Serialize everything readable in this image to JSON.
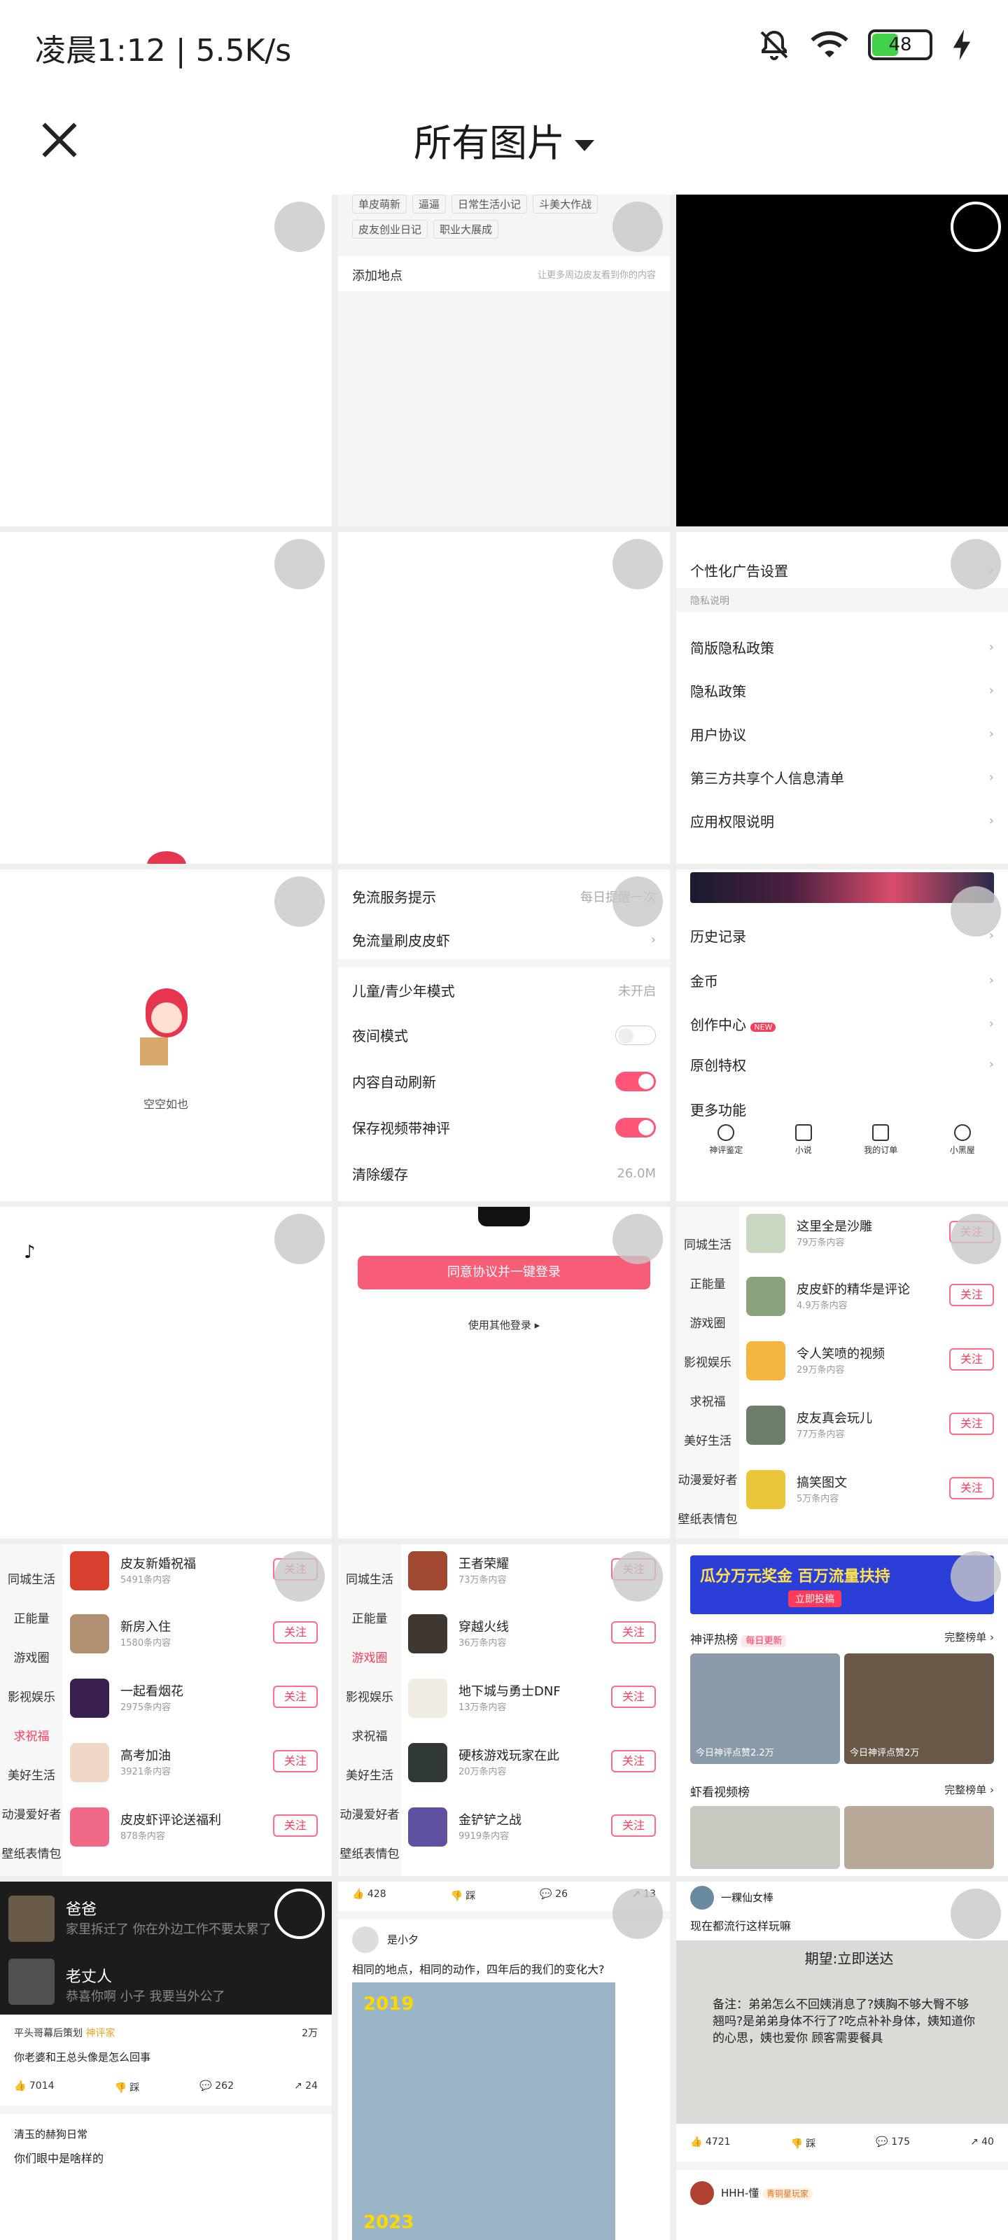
{
  "status": {
    "time": "凌晨1:12 | 5.5K/s",
    "battery": 48,
    "icons": [
      "bell-off-icon",
      "wifi-icon",
      "battery-icon",
      "charging-icon"
    ]
  },
  "header": {
    "title": "所有图片"
  },
  "colors": {
    "accent": "#ff3b5c",
    "toggle_on": "#ff5577"
  },
  "cell1_2": {
    "tags_row1": [
      "单皮萌新",
      "逼逼",
      "日常生活小记",
      "斗美大作战"
    ],
    "tags_row2": [
      "皮友创业日记",
      "职业大展成"
    ],
    "location": "添加地点",
    "location_hint": "让更多周边皮友看到你的内容"
  },
  "cell2_3": {
    "ad_settings": "个性化广告设置",
    "section": "隐私说明",
    "items": [
      "简版隐私政策",
      "隐私政策",
      "用户协议",
      "第三方共享个人信息清单",
      "应用权限说明"
    ]
  },
  "cell3_1": {
    "empty": "空空如也"
  },
  "cell3_2": {
    "rows": [
      {
        "label": "免流服务提示",
        "value": "每日提醒一次"
      },
      {
        "label": "免流量刷皮皮虾",
        "value": ""
      },
      {
        "label": "儿童/青少年模式",
        "value": "未开启"
      },
      {
        "label": "夜间模式",
        "value": ""
      },
      {
        "label": "内容自动刷新",
        "value": ""
      },
      {
        "label": "保存视频带神评",
        "value": ""
      },
      {
        "label": "清除缓存",
        "value": "26.0M"
      }
    ]
  },
  "cell3_3": {
    "rows": [
      "历史记录",
      "金币",
      "创作中心",
      "原创特权",
      "更多功能"
    ],
    "new_badge": "NEW",
    "tools": [
      "神评鉴定",
      "小说",
      "我的订单",
      "小黑屋"
    ]
  },
  "cell4_2": {
    "login": "同意协议并一键登录",
    "other": "使用其他登录"
  },
  "cell4_3": {
    "side": [
      "同城生活",
      "正能量",
      "游戏圈",
      "影视娱乐",
      "求祝福",
      "美好生活",
      "动漫爱好者",
      "壁纸表情包"
    ],
    "items": [
      {
        "name": "这里全是沙雕",
        "sub": "79万条内容"
      },
      {
        "name": "皮皮虾的精华是评论",
        "sub": "4.9万条内容"
      },
      {
        "name": "令人笑喷的视频",
        "sub": "29万条内容"
      },
      {
        "name": "皮友真会玩儿",
        "sub": "77万条内容"
      },
      {
        "name": "搞笑图文",
        "sub": "5万条内容"
      }
    ],
    "follow": "关注"
  },
  "cell5_1": {
    "side": [
      "同城生活",
      "正能量",
      "游戏圈",
      "影视娱乐",
      "求祝福",
      "美好生活",
      "动漫爱好者",
      "壁纸表情包"
    ],
    "items": [
      {
        "name": "皮友新婚祝福",
        "sub": "5491条内容"
      },
      {
        "name": "新房入住",
        "sub": "1580条内容"
      },
      {
        "name": "一起看烟花",
        "sub": "2975条内容"
      },
      {
        "name": "高考加油",
        "sub": "3921条内容"
      },
      {
        "name": "皮皮虾评论送福利",
        "sub": "878条内容"
      }
    ]
  },
  "cell5_2": {
    "side": [
      "同城生活",
      "正能量",
      "游戏圈",
      "影视娱乐",
      "求祝福",
      "美好生活",
      "动漫爱好者",
      "壁纸表情包"
    ],
    "items": [
      {
        "name": "王者荣耀",
        "sub": "73万条内容"
      },
      {
        "name": "穿越火线",
        "sub": "36万条内容"
      },
      {
        "name": "地下城与勇士DNF",
        "sub": "13万条内容"
      },
      {
        "name": "硬核游戏玩家在此",
        "sub": "20万条内容"
      },
      {
        "name": "金铲铲之战",
        "sub": "9919条内容"
      }
    ]
  },
  "cell5_3": {
    "banner": "瓜分万元奖金 百万流量扶持",
    "banner_btn": "立即投稿",
    "hot": "神评热榜",
    "daily": "每日更新",
    "full": "完整榜单",
    "captions": [
      "今日神评点赞2.2万",
      "今日神评点赞2万"
    ],
    "video_rank": "虾看视频榜"
  },
  "cell6_1": {
    "chat": [
      {
        "name": "爸爸",
        "msg": "家里拆迁了 你在外边工作不要太累了"
      },
      {
        "name": "老丈人",
        "msg": "恭喜你啊 小子 我要当外公了"
      }
    ],
    "author": "平头哥幕后策划",
    "badge": "神评家",
    "count": "2万",
    "caption": "你老婆和王总头像是怎么回事",
    "stats": [
      "7014",
      "踩",
      "262",
      "24"
    ],
    "next_author": "清玉的赫狗日常",
    "next_caption": "你们眼中是啥样的"
  },
  "cell6_2": {
    "stats": [
      "428",
      "踩",
      "26",
      "13"
    ],
    "author": "是小夕",
    "caption": "相同的地点，相同的动作，四年后的我们的变化大?",
    "year1": "2019",
    "year2": "2023"
  },
  "cell6_3": {
    "author": "一粿仙女棒",
    "caption": "现在都流行这样玩嘛",
    "receipt_title": "期望:立即送达",
    "receipt_text": "备注：弟弟怎么不回姨消息了?姨胸不够大臀不够翘吗?是弟弟身体不行了?吃点补补身体，姨知道你的心思，姨也爱你 顾客需要餐具",
    "stats": [
      "4721",
      "踩",
      "175",
      "40"
    ],
    "next_author": "HHH-懂",
    "next_badge": "青铜星玩家"
  }
}
